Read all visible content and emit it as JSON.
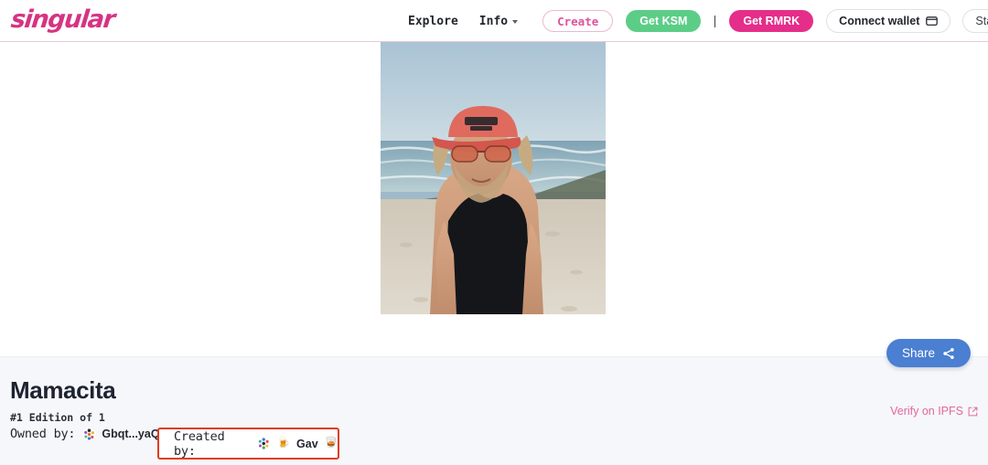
{
  "navbar": {
    "logo_text": "singular",
    "links": [
      {
        "label": "Explore",
        "icon": ""
      },
      {
        "label": "Info",
        "icon": "chevron-down-icon"
      }
    ],
    "create_label": "Create",
    "get_ksm_label": "Get KSM",
    "get_rmrk_label": "Get RMRK",
    "connect_wallet_label": "Connect wallet",
    "wallet_icon": "wallet-icon",
    "network_label": "Statemine",
    "network_chevron": "chevron-down-icon",
    "theme_icon": "moon-icon",
    "separator": "|",
    "brand_color": "#d63384",
    "ksm_color": "#5ccd87",
    "rmrk_color": "#e52d8a"
  },
  "artwork": {
    "alt": "Beach portrait: person in red cap, sunglasses and black tank top by the sea",
    "frame_bg": "#9fb9cb"
  },
  "detail": {
    "title": "Mamacita",
    "edition": "#1 Edition of 1",
    "owned_by_label": "Owned by:",
    "owner_address": "Gbqt...yaQB",
    "owner_avatar": "identicon-avatar",
    "created_by_label": "Created by:",
    "creator_avatar": "identicon-avatar",
    "creator_emoji_left": "🍺",
    "creator_name": "Gav",
    "creator_emoji_right": "🥃",
    "highlight_color": "#e03b1c",
    "share_label": "Share",
    "share_icon": "share-icon",
    "share_color": "#4a7fd1",
    "ipfs_label": "Verify on IPFS",
    "ipfs_icon": "external-link-icon",
    "ipfs_color": "#e2679f"
  }
}
